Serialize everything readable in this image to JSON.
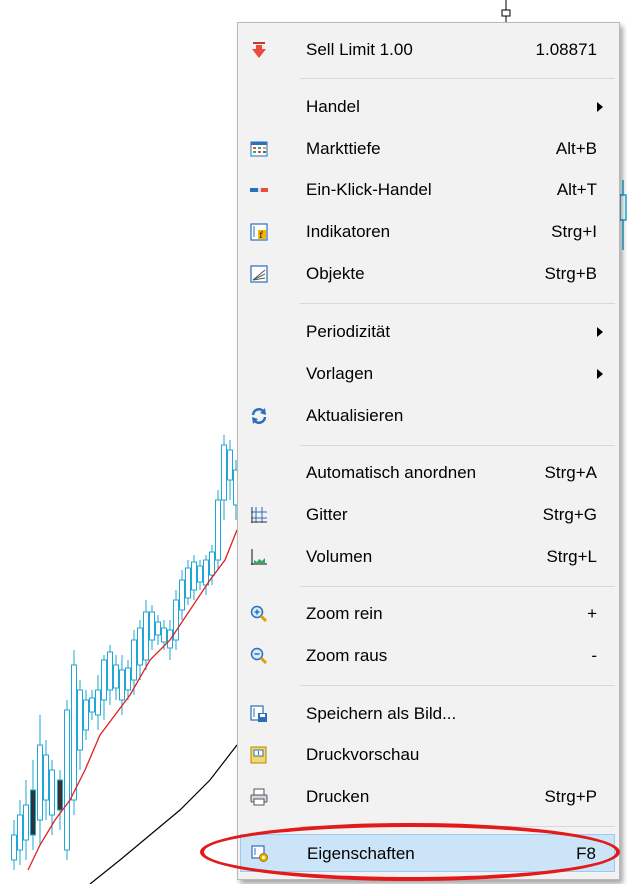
{
  "menu": {
    "items": [
      {
        "label": "Sell Limit 1.00",
        "shortcut": "1.08871",
        "icon": "sell-arrow-icon"
      },
      {
        "label": "Handel",
        "shortcut": "",
        "submenu": true
      },
      {
        "label": "Markttiefe",
        "shortcut": "Alt+B",
        "icon": "market-depth-icon"
      },
      {
        "label": "Ein-Klick-Handel",
        "shortcut": "Alt+T",
        "icon": "one-click-trading-icon"
      },
      {
        "label": "Indikatoren",
        "shortcut": "Strg+I",
        "icon": "indicators-icon"
      },
      {
        "label": "Objekte",
        "shortcut": "Strg+B",
        "icon": "objects-icon"
      },
      {
        "label": "Periodizität",
        "shortcut": "",
        "submenu": true
      },
      {
        "label": "Vorlagen",
        "shortcut": "",
        "submenu": true
      },
      {
        "label": "Aktualisieren",
        "shortcut": "",
        "icon": "refresh-icon"
      },
      {
        "label": "Automatisch anordnen",
        "shortcut": "Strg+A"
      },
      {
        "label": "Gitter",
        "shortcut": "Strg+G",
        "icon": "grid-icon"
      },
      {
        "label": "Volumen",
        "shortcut": "Strg+L",
        "icon": "volume-icon"
      },
      {
        "label": "Zoom rein",
        "shortcut": "+",
        "icon": "zoom-in-icon"
      },
      {
        "label": "Zoom raus",
        "shortcut": "-",
        "icon": "zoom-out-icon"
      },
      {
        "label": "Speichern als Bild...",
        "shortcut": "",
        "icon": "save-image-icon"
      },
      {
        "label": "Druckvorschau",
        "shortcut": "",
        "icon": "print-preview-icon"
      },
      {
        "label": "Drucken",
        "shortcut": "Strg+P",
        "icon": "printer-icon"
      },
      {
        "label": "Eigenschaften",
        "shortcut": "F8",
        "icon": "properties-icon"
      }
    ]
  },
  "colors": {
    "candle": "#1ea7d6",
    "moving_average_red": "#e02020",
    "moving_average_black": "#000000",
    "highlight": "#cce4f7",
    "annotation_oval": "#e21a1a"
  }
}
